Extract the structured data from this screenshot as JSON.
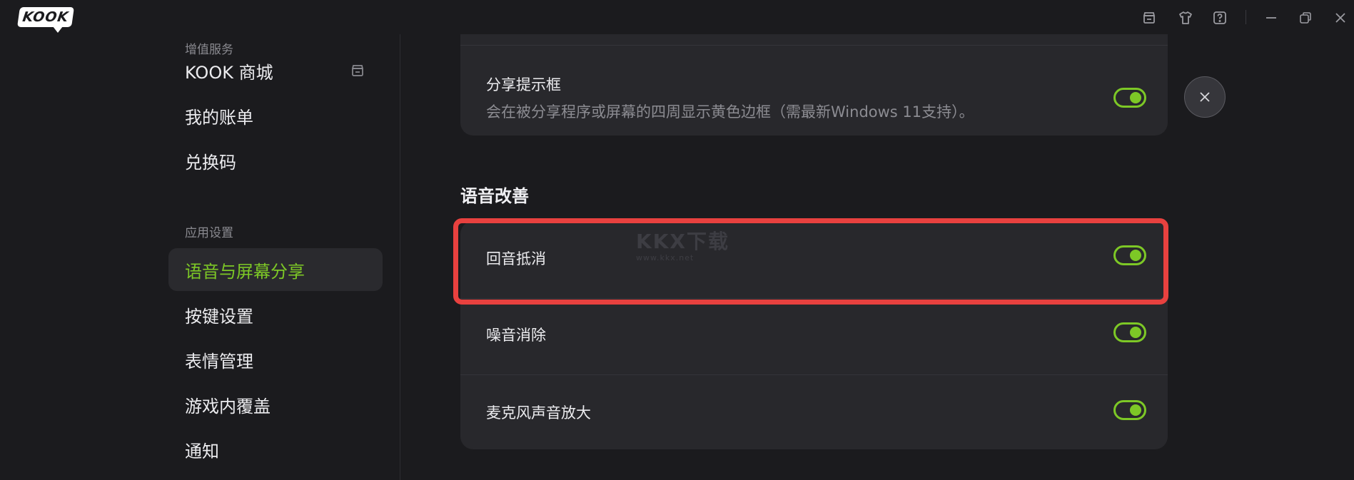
{
  "app": {
    "logo_text": "KOOK"
  },
  "titlebar": {
    "icons": [
      "shop-icon",
      "tshirt-icon",
      "help-icon",
      "minimize-icon",
      "restore-icon",
      "close-icon"
    ]
  },
  "sidebar": {
    "sections": [
      {
        "label": "增值服务"
      },
      {
        "label": "应用设置"
      }
    ],
    "items": [
      {
        "label": "KOOK 商城"
      },
      {
        "label": "我的账单"
      },
      {
        "label": "兑换码"
      },
      {
        "label": "语音与屏幕分享",
        "active": true
      },
      {
        "label": "按键设置"
      },
      {
        "label": "表情管理"
      },
      {
        "label": "游戏内覆盖"
      },
      {
        "label": "通知"
      }
    ]
  },
  "content": {
    "share_card": {
      "title": "分享提示框",
      "description": "会在被分享程序或屏幕的四周显示黄色边框（需最新Windows 11支持）。",
      "enabled": true
    },
    "voice_group": {
      "title": "语音改善",
      "rows": [
        {
          "title": "回音抵消",
          "enabled": true
        },
        {
          "title": "噪音消除",
          "enabled": true
        },
        {
          "title": "麦克风声音放大",
          "enabled": true
        }
      ]
    },
    "watermark": {
      "main": "KKX下载",
      "sub": "www.kkx.net"
    }
  },
  "colors": {
    "accent": "#7dc826",
    "highlight": "#e8413f",
    "background": "#1b1b1e",
    "card": "#28282c"
  }
}
